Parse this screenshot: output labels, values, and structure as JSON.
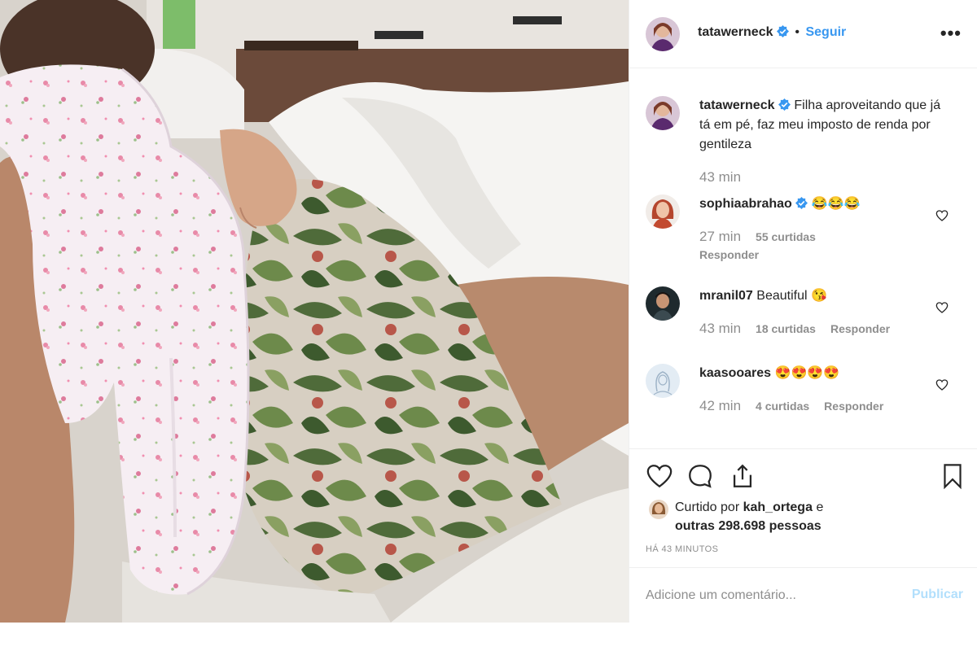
{
  "post": {
    "author": "tatawerneck",
    "follow_label": "Seguir",
    "separator": "•",
    "more_label": "•••",
    "caption": "Filha aproveitando que já tá em pé, faz meu imposto de renda por gentileza",
    "caption_time": "43 min"
  },
  "comments": [
    {
      "user": "sophiaabrahao",
      "text": "😂😂😂",
      "time": "27 min",
      "likes": "55 curtidas",
      "reply": "Responder",
      "verified": true
    },
    {
      "user": "mranil07",
      "text": "Beautiful 😘",
      "time": "43 min",
      "likes": "18 curtidas",
      "reply": "Responder",
      "verified": false
    },
    {
      "user": "kaasooares",
      "text": "😍😍😍😍",
      "time": "42 min",
      "likes": "4 curtidas",
      "reply": "Responder",
      "verified": false
    }
  ],
  "likes": {
    "prefix": "Curtido por",
    "user": "kah_ortega",
    "conj": "e",
    "others": "outras 298.698 pessoas"
  },
  "time_ago": "HÁ 43 MINUTOS",
  "add_comment": {
    "placeholder": "Adicione um comentário...",
    "publish": "Publicar"
  },
  "colors": {
    "link_blue": "#3897f0",
    "publish_disabled": "#b2dffc",
    "muted": "#8e8e8e",
    "verified_blue": "#3897f0"
  }
}
